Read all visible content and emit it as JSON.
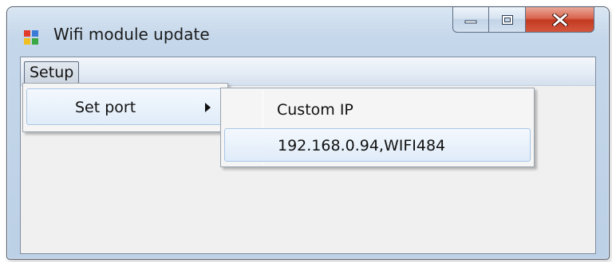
{
  "window": {
    "title": "Wifi module update",
    "icon": "app-window-icon"
  },
  "caption_buttons": {
    "minimize_icon": "minimize-icon",
    "maximize_icon": "maximize-icon",
    "close_icon": "close-icon"
  },
  "menu_bar": {
    "items": [
      {
        "label": "Setup"
      }
    ]
  },
  "setup_menu": {
    "items": [
      {
        "label": "Set port",
        "has_submenu": true
      }
    ]
  },
  "set_port_submenu": {
    "items": [
      {
        "label": "Custom IP"
      },
      {
        "label": "192.168.0.94,WIFI484"
      }
    ]
  },
  "colors": {
    "title_bar": "#c5d7ea",
    "close_button": "#c43a22",
    "hover_highlight": "#e0ecf9",
    "client_background": "#f0f0f0"
  }
}
